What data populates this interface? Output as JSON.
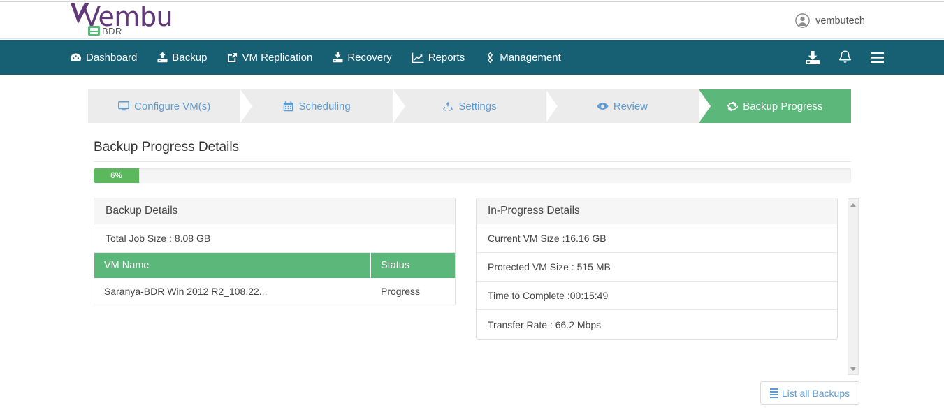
{
  "header": {
    "logo_text": "Vembu",
    "logo_subtext": "BDR",
    "logo_badge_icon": "server-icon",
    "user": {
      "name": "vembutech",
      "avatar_icon": "user-circle-icon"
    }
  },
  "nav": {
    "items": [
      {
        "label": "Dashboard",
        "icon": "dashboard-icon"
      },
      {
        "label": "Backup",
        "icon": "upload-icon"
      },
      {
        "label": "VM Replication",
        "icon": "external-link-icon"
      },
      {
        "label": "Recovery",
        "icon": "download-icon"
      },
      {
        "label": "Reports",
        "icon": "chart-line-icon"
      },
      {
        "label": "Management",
        "icon": "settings-diamond-icon"
      }
    ],
    "actions": [
      {
        "name": "download-icon"
      },
      {
        "name": "bell-icon"
      },
      {
        "name": "hamburger-icon"
      }
    ]
  },
  "wizard": {
    "steps": [
      {
        "label": "Configure VM(s)",
        "icon": "monitor-icon",
        "active": false
      },
      {
        "label": "Scheduling",
        "icon": "calendar-icon",
        "active": false
      },
      {
        "label": "Settings",
        "icon": "recycle-icon",
        "active": false
      },
      {
        "label": "Review",
        "icon": "eye-icon",
        "active": false
      },
      {
        "label": "Backup Progress",
        "icon": "refresh-icon",
        "active": true
      }
    ]
  },
  "main": {
    "title": "Backup Progress Details",
    "progress": {
      "percent": 6,
      "label": "6%",
      "fill_color": "#5cb85c",
      "track_color": "#f5f5f5"
    },
    "backup_details": {
      "heading": "Backup Details",
      "summary": "Total Job Size : 8.08 GB",
      "table": {
        "columns": [
          "VM Name",
          "Status"
        ],
        "header_color": "#5cb87a",
        "rows": [
          {
            "vm_name": "Saranya-BDR Win 2012 R2_108.22...",
            "status": "Progress"
          }
        ]
      }
    },
    "in_progress_details": {
      "heading": "In-Progress Details",
      "rows": [
        "Current VM Size :16.16 GB",
        "Protected VM Size : 515 MB",
        "Time to Complete :00:15:49",
        "Transfer Rate : 66.2 Mbps"
      ]
    },
    "footer": {
      "list_all_backups_label": "List all Backups",
      "list_all_backups_icon": "list-icon"
    }
  },
  "colors": {
    "nav_background": "#175f72",
    "accent_green": "#5cb87a",
    "link_blue": "#5d9bd5",
    "brand_purple": "#63387a"
  }
}
